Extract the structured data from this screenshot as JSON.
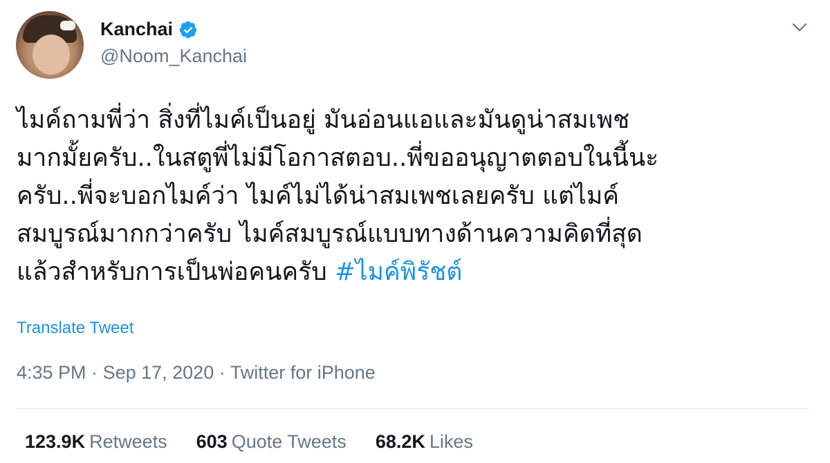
{
  "user": {
    "display_name": "Kanchai",
    "handle": "@Noom_Kanchai",
    "verified_icon": "verified-badge-icon"
  },
  "tweet": {
    "lines": [
      "ไมค์ถามพี่ว่า สิ่งที่ไมค์เป็นอยู่ มันอ่อนแอและมันดูน่าสมเพช",
      "มากมั้ยครับ..ในสตูพี่ไม่มีโอกาสตอบ..พี่ขออนุญาตตอบในนี้นะ",
      "ครับ..พี่จะบอกไมค์ว่า ไมค์ไม่ได้น่าสมเพชเลยครับ แต่ไมค์",
      "สมบูรณ์มากกว่าครับ ไมค์สมบูรณ์แบบทางด้านความคิดที่สุด",
      "แล้วสำหรับการเป็นพ่อคนครับ "
    ],
    "hashtag": "#ไมค์พิรัชต์",
    "translate_label": "Translate Tweet",
    "time": "4:35 PM",
    "date": "Sep 17, 2020",
    "source": "Twitter for iPhone",
    "separator": " · "
  },
  "stats": {
    "retweets_count": "123.9K",
    "retweets_label": "Retweets",
    "quotes_count": "603",
    "quotes_label": "Quote Tweets",
    "likes_count": "68.2K",
    "likes_label": "Likes"
  },
  "colors": {
    "link": "#1b95e0",
    "secondary_text": "#657786",
    "primary_text": "#14171a",
    "divider": "#e1e8ed"
  }
}
